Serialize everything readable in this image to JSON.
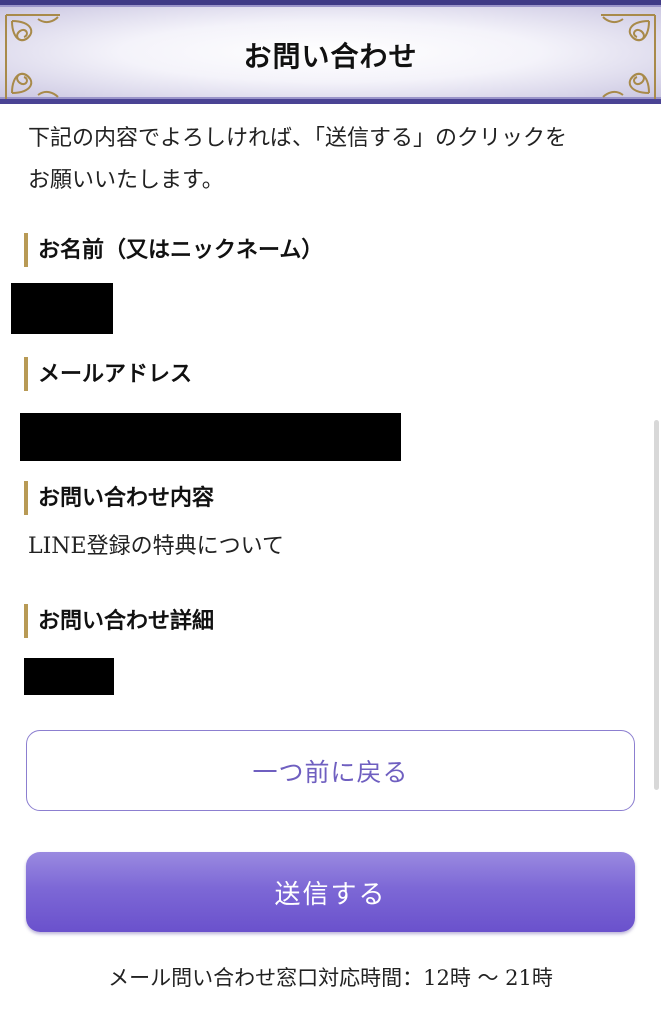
{
  "header": {
    "title": "お問い合わせ"
  },
  "intro": {
    "line1": "下記の内容でよろしければ、「送信する」のクリックを",
    "line2": "お願いいたします。"
  },
  "fields": {
    "name_label": "お名前（又はニックネーム）",
    "email_label": "メールアドレス",
    "inquiry_label": "お問い合わせ内容",
    "inquiry_value": "LINE登録の特典について",
    "detail_label": "お問い合わせ詳細"
  },
  "buttons": {
    "back_label": "一つ前に戻る",
    "submit_label": "送信する"
  },
  "footer": {
    "hours": "メール問い合わせ窓口対応時間：12時 〜 21時"
  },
  "colors": {
    "accent_purple": "#6f5fc0",
    "submit_gradient_top": "#9a8ae0",
    "submit_gradient_bottom": "#6a51cc",
    "label_bar_gold": "#b89a55",
    "header_border": "#3f3a86"
  }
}
